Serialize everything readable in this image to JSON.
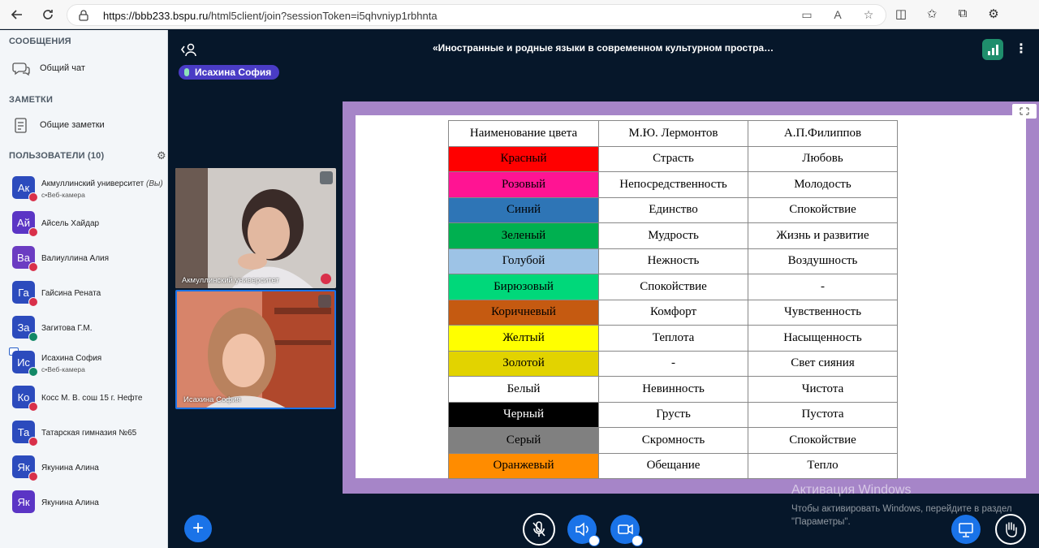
{
  "browser": {
    "url_host": "https://bbb233.bspu.ru",
    "url_path": "/html5client/join?sessionToken=i5qhvniyp1rbhnta"
  },
  "sidebar": {
    "messages_title": "СООБЩЕНИЯ",
    "public_chat": "Общий чат",
    "notes_title": "ЗАМЕТКИ",
    "shared_notes": "Общие заметки",
    "users_title": "ПОЛЬЗОВАТЕЛИ (10)",
    "users": [
      {
        "initials": "Ак",
        "name": "Акмуллинский университет",
        "you": "(Вы)",
        "sub": "с•Веб-камера",
        "color": "#2c4bbd",
        "mic": "muted"
      },
      {
        "initials": "Ай",
        "name": "Айсель Хайдар",
        "sub": "",
        "color": "#5b35c5",
        "mic": "muted"
      },
      {
        "initials": "Ва",
        "name": "Валиуллина Алия",
        "sub": "",
        "color": "#6b3cc2",
        "mic": "muted"
      },
      {
        "initials": "Га",
        "name": "Гайсина Рената",
        "sub": "",
        "color": "#2c4bbd",
        "mic": "muted"
      },
      {
        "initials": "За",
        "name": "Загитова Г.М.",
        "sub": "",
        "color": "#2c4bbd",
        "mic": "on"
      },
      {
        "initials": "Ис",
        "name": "Исахина София",
        "sub": "с•Веб-камера",
        "color": "#2c4bbd",
        "mic": "on"
      },
      {
        "initials": "Ко",
        "name": "Косс М. В. сош 15 г. Нефте",
        "sub": "",
        "color": "#2c4bbd",
        "mic": "muted"
      },
      {
        "initials": "Та",
        "name": "Татарская гимназия №65",
        "sub": "",
        "color": "#2c4bbd",
        "mic": "muted"
      },
      {
        "initials": "Як",
        "name": "Якунина Алина",
        "sub": "",
        "color": "#2c4bbd",
        "mic": "muted"
      },
      {
        "initials": "Як",
        "name": "Якунина Алина",
        "sub": "",
        "color": "#5b35c5",
        "mic": "none"
      }
    ]
  },
  "main": {
    "meeting_title": "«Иностранные и родные языки в современном культурном простра…",
    "talking_indicator": "Исахина София",
    "videos": [
      {
        "caption": "Акмуллинский университет"
      },
      {
        "caption": "Исахина София"
      }
    ]
  },
  "table": {
    "headers": [
      "Наименование цвета",
      "М.Ю. Лермонтов",
      "А.П.Филиппов"
    ],
    "rows": [
      {
        "color": "Красный",
        "bg": "#ff0000",
        "fg": "#000000",
        "lermontov": "Страсть",
        "filippov": "Любовь"
      },
      {
        "color": "Розовый",
        "bg": "#ff1493",
        "fg": "#000000",
        "lermontov": "Непосредственность",
        "filippov": "Молодость"
      },
      {
        "color": "Синий",
        "bg": "#2e75b6",
        "fg": "#000000",
        "lermontov": "Единство",
        "filippov": "Спокойствие"
      },
      {
        "color": "Зеленый",
        "bg": "#00b050",
        "fg": "#000000",
        "lermontov": "Мудрость",
        "filippov": "Жизнь и развитие"
      },
      {
        "color": "Голубой",
        "bg": "#9dc3e6",
        "fg": "#000000",
        "lermontov": "Нежность",
        "filippov": "Воздушность"
      },
      {
        "color": "Бирюзовый",
        "bg": "#00d87a",
        "fg": "#000000",
        "lermontov": "Спокойствие",
        "filippov": "-"
      },
      {
        "color": "Коричневый",
        "bg": "#c55a11",
        "fg": "#000000",
        "lermontov": "Комфорт",
        "filippov": "Чувственность"
      },
      {
        "color": "Желтый",
        "bg": "#ffff00",
        "fg": "#000000",
        "lermontov": "Теплота",
        "filippov": "Насыщенность"
      },
      {
        "color": "Золотой",
        "bg": "#e2d300",
        "fg": "#000000",
        "lermontov": "-",
        "filippov": "Свет сияния"
      },
      {
        "color": "Белый",
        "bg": "#ffffff",
        "fg": "#000000",
        "lermontov": "Невинность",
        "filippov": "Чистота"
      },
      {
        "color": "Черный",
        "bg": "#000000",
        "fg": "#ffffff",
        "lermontov": "Грусть",
        "filippov": "Пустота"
      },
      {
        "color": "Серый",
        "bg": "#808080",
        "fg": "#000000",
        "lermontov": "Скромность",
        "filippov": "Спокойствие"
      },
      {
        "color": "Оранжевый",
        "bg": "#ff8c00",
        "fg": "#000000",
        "lermontov": "Обещание",
        "filippov": "Тепло"
      }
    ]
  },
  "watermark": {
    "line1": "Активация Windows",
    "line2": "Чтобы активировать Windows, перейдите в раздел",
    "line3": "\"Параметры\"."
  },
  "colors": {
    "primary": "#1a73e8",
    "slide_border": "#a685c8",
    "main_bg": "#06172a",
    "talker_bg": "#4a3cc5"
  }
}
